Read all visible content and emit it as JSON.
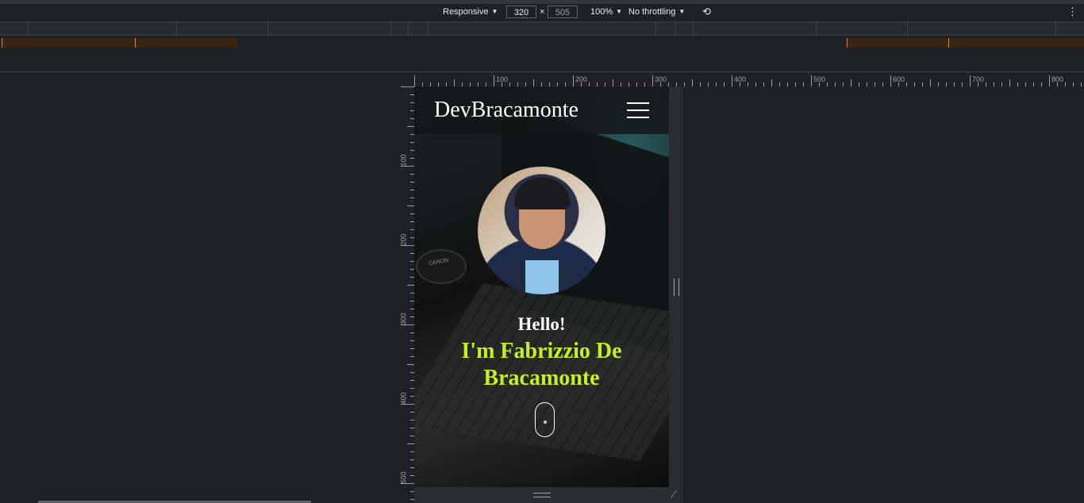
{
  "devtools": {
    "device": "Responsive",
    "width": "320",
    "height": "505",
    "zoom": "100%",
    "throttling": "No throttling",
    "ruler_top": [
      "100",
      "200",
      "300",
      "400",
      "500",
      "600",
      "700",
      "800"
    ],
    "ruler_left": [
      "100",
      "200",
      "300",
      "400",
      "500"
    ]
  },
  "site": {
    "brand": "DevBracamonte",
    "greeting": "Hello!",
    "intro": "I'm Fabrizzio De Bracamonte",
    "lens_text": "CANON",
    "accent_color": "#c6f025"
  }
}
